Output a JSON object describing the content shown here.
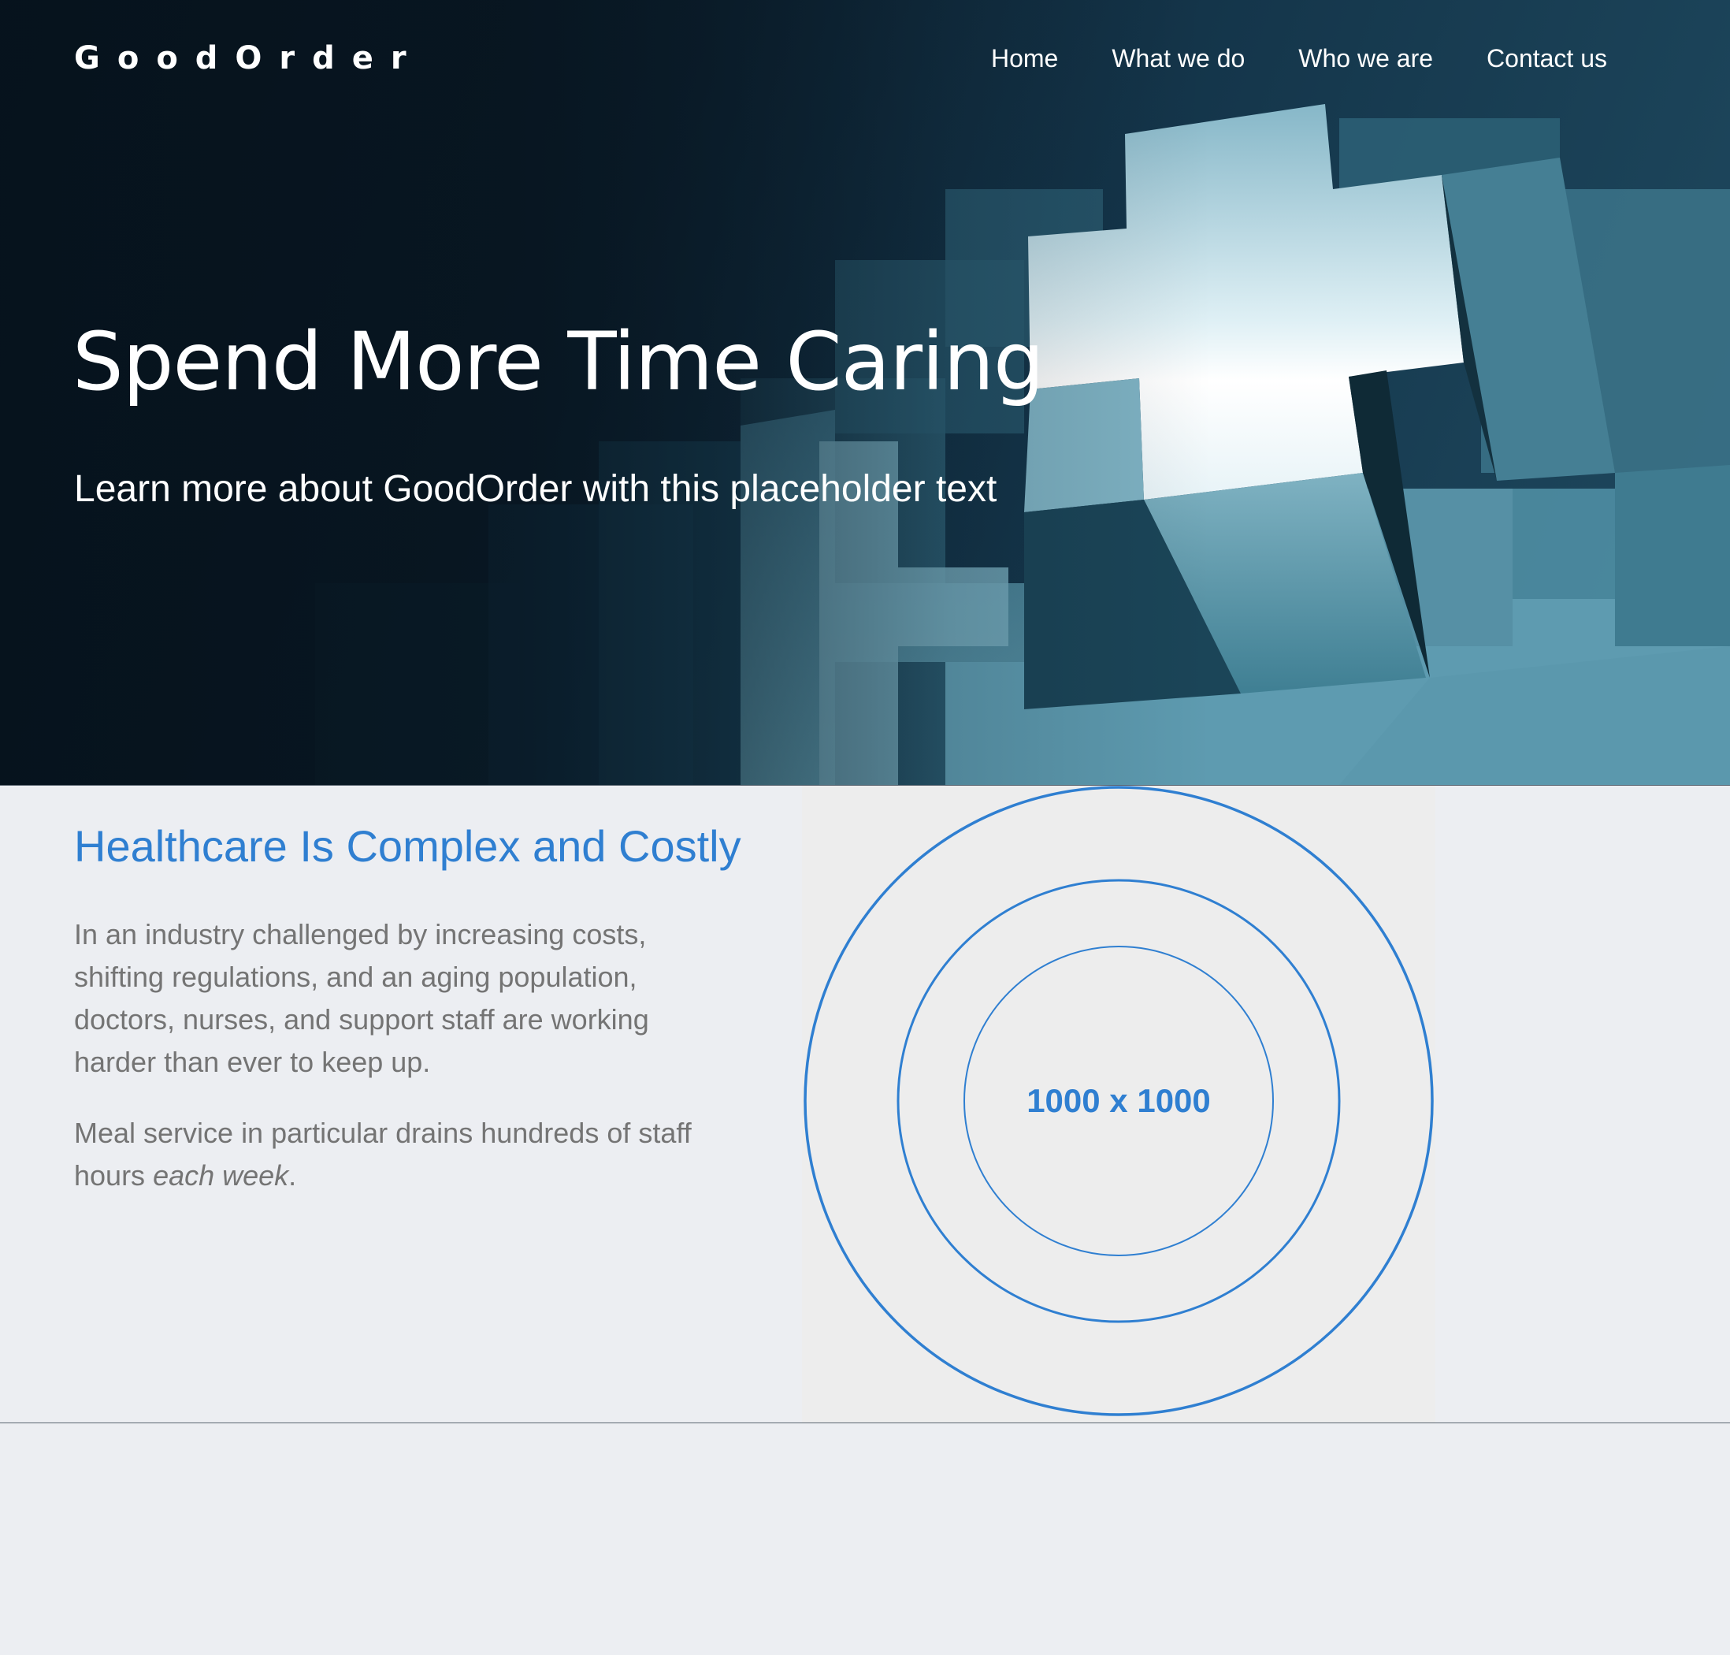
{
  "header": {
    "brand": "GoodOrder",
    "nav": [
      {
        "label": "Home"
      },
      {
        "label": "What we do"
      },
      {
        "label": "Who we are"
      },
      {
        "label": "Contact us"
      }
    ]
  },
  "hero": {
    "title": "Spend More Time Caring",
    "subtitle": "Learn more about GoodOrder with this placeholder text"
  },
  "section": {
    "title": "Healthcare Is Complex and Costly",
    "paragraph1": "In an industry challenged by increasing costs, shifting regulations, and an aging population, doctors, nurses, and support staff are working harder than ever to keep up.",
    "paragraph2_start": "Meal service in particular drains hundreds of staff hours ",
    "paragraph2_em": "each week",
    "paragraph2_end": ".",
    "placeholder_label": "1000 x 1000"
  },
  "colors": {
    "accent": "#2f7fd1",
    "body_text": "#747474",
    "page_background": "#eceef2",
    "hero_dark": "#0a1a26"
  }
}
